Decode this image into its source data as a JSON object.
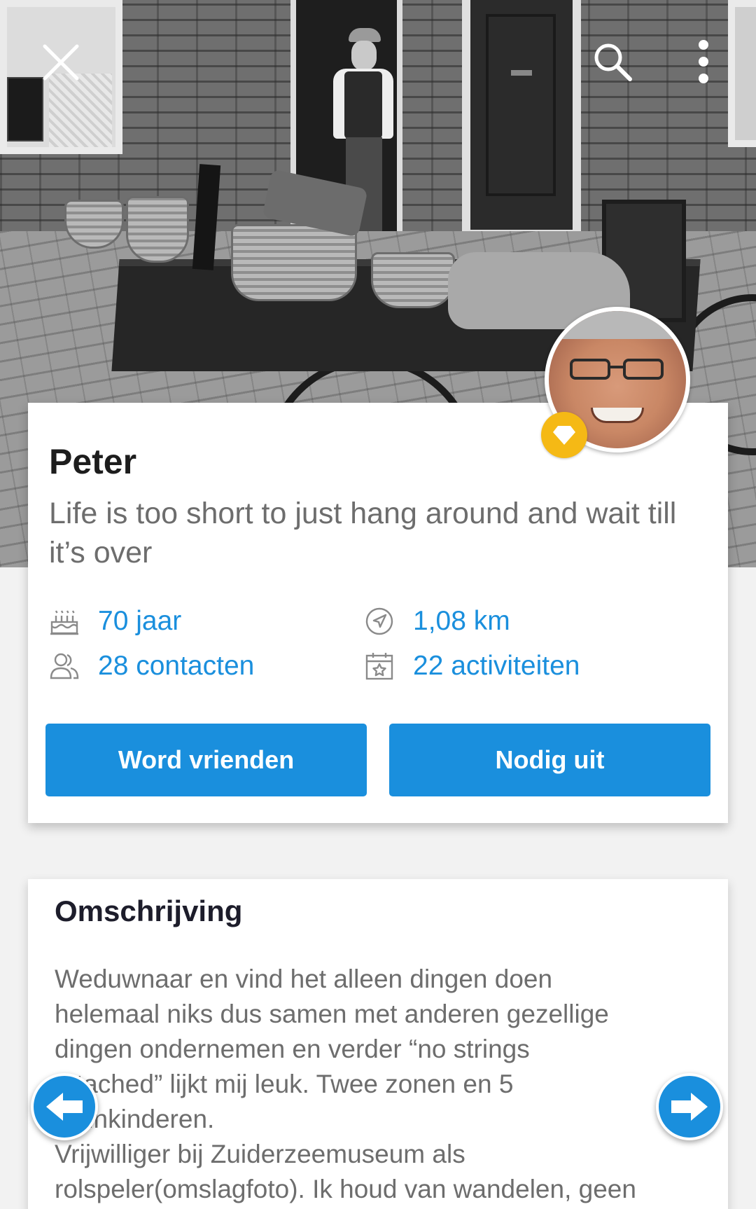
{
  "profile": {
    "name": "Peter",
    "tagline": "Life is too short to just hang around and wait till it’s over",
    "age": "70 jaar",
    "distance": "1,08 km",
    "contacts": "28 contacten",
    "activities": "22 activiteiten"
  },
  "actions": {
    "friend_label": "Word vrienden",
    "invite_label": "Nodig uit"
  },
  "description": {
    "title": "Omschrijving",
    "text": "Weduwnaar en vind het alleen dingen doen\nhelemaal niks dus samen met anderen gezellige\ndingen ondernemen en verder “no strings\nattached” lijkt mij leuk. Twee zonen en 5\nkleinkinderen.\nVrijwilliger bij Zuiderzeemuseum als\nrolspeler(omslagfoto). Ik houd van wandelen, geen"
  },
  "icons": {
    "close": "close-icon",
    "search": "search-icon",
    "more": "more-vertical-icon",
    "age": "birthday-cake-icon",
    "distance": "location-arrow-icon",
    "contacts": "contacts-icon",
    "activities": "calendar-star-icon",
    "badge": "diamond-icon",
    "prev": "arrow-left-icon",
    "next": "arrow-right-icon"
  },
  "colors": {
    "accent": "#1a8fdd",
    "badge": "#f5b915",
    "name_text": "#1d1d1d",
    "muted_text": "#6d6d6d"
  }
}
